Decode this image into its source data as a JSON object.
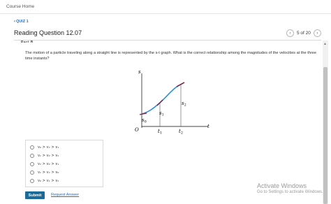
{
  "header": {
    "course_home": "Course Home"
  },
  "nav": {
    "quiz_link": "QUIZ 1"
  },
  "page": {
    "title": "Reading Question 12.07"
  },
  "pager": {
    "text": "5 of 20",
    "prev_icon": "chevron-left-icon",
    "next_icon": "chevron-right-icon"
  },
  "part_label": "Part B",
  "question": {
    "text": "The motion of a particle traveling along a straight line is represented by the s-t graph. What is the correct relationship among the magnitudes of the velocities at the three time instants?"
  },
  "figure": {
    "y_axis": "s",
    "x_axis": "t",
    "origin": "O",
    "t1": "t",
    "t1_sub": "1",
    "t2": "t",
    "t2_sub": "2",
    "s0": "s",
    "s0_sub": "0",
    "s1": "s",
    "s1_sub": "1",
    "s2": "s",
    "s2_sub": "2",
    "curve_color": "#2f8fd0",
    "tangent_color": "#8b1a3a"
  },
  "choices": [
    {
      "label": "v₀ > v₂ > v₁"
    },
    {
      "label": "v₁ > v₀ > v₂"
    },
    {
      "label": "v₂ > v₀ > v₁"
    },
    {
      "label": "v₁ > v₂ > v₀"
    },
    {
      "label": "v₀ > v₁ > v₂"
    }
  ],
  "actions": {
    "submit": "Submit",
    "request_answer": "Request Answer"
  },
  "watermark": {
    "title": "Activate Windows",
    "subtitle": "Go to Settings to activate Windows."
  },
  "colors": {
    "accent": "#1b6a98",
    "link": "#2a6fb7"
  }
}
